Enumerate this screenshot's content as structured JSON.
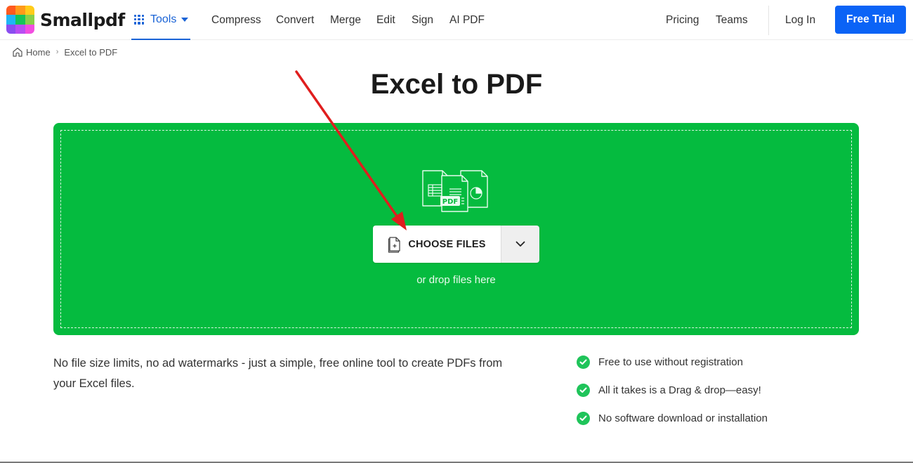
{
  "brand": {
    "name": "Smallpdf",
    "logo_colors": [
      "#ff5a1f",
      "#ff9a1a",
      "#ffcc1a",
      "#1fb5f5",
      "#15c45a",
      "#8ad04a",
      "#8a4df0",
      "#b84ef2",
      "#f24ee0"
    ]
  },
  "header": {
    "tools_label": "Tools",
    "tools_icon": "grid-icon",
    "nav": [
      "Compress",
      "Convert",
      "Merge",
      "Edit",
      "Sign",
      "AI PDF"
    ],
    "pricing_label": "Pricing",
    "teams_label": "Teams",
    "login_label": "Log In",
    "free_trial_label": "Free Trial"
  },
  "breadcrumb": {
    "home_label": "Home",
    "separator": "›",
    "current_label": "Excel to PDF"
  },
  "page": {
    "title": "Excel to PDF"
  },
  "dropzone": {
    "choose_files_label": "CHOOSE FILES",
    "drop_text": "or drop files here",
    "pdf_badge": "PDF",
    "accent_color": "#05bb3f"
  },
  "info": {
    "description": "No file size limits, no ad watermarks - just a simple, free online tool to create PDFs from your Excel files.",
    "features": [
      "Free to use without registration",
      "All it takes is a Drag & drop—easy!",
      "No software download or installation"
    ]
  },
  "colors": {
    "primary_blue": "#0b63f6",
    "check_green": "#1fc45a",
    "annotation_red": "#e01e1e"
  }
}
